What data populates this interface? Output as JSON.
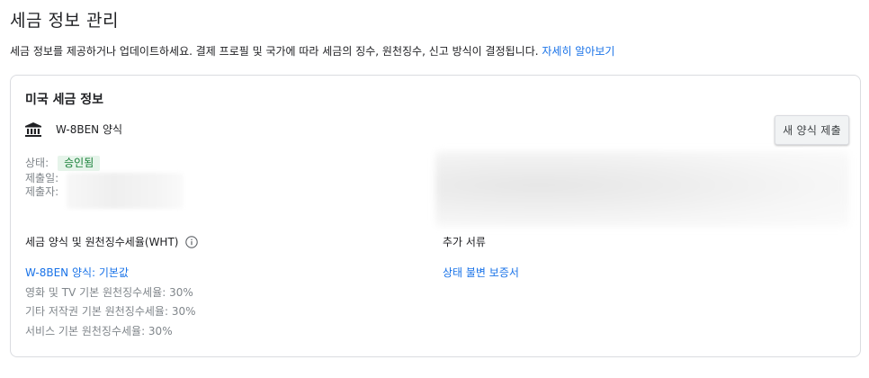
{
  "header": {
    "title": "세금 정보 관리",
    "description": "세금 정보를 제공하거나 업데이트하세요. 결제 프로필 및 국가에 따라 세금의 징수, 원천징수, 신고 방식이 결정됩니다.",
    "learn_more": "자세히 알아보기"
  },
  "card": {
    "title": "미국 세금 정보",
    "form_icon": "bank-icon",
    "form_name": "W-8BEN 양식",
    "submit_button": "새 양식 제출",
    "status_label": "상태:",
    "status_value": "승인됨",
    "submitted_date_label": "제출일:",
    "submitter_label": "제출자:",
    "wht_section_label": "세금 양식 및 원천징수세율(WHT)",
    "info_icon": "info-icon",
    "extra_docs_label": "추가 서류",
    "wht_details": {
      "form_default": "W-8BEN 양식: 기본값",
      "film_tv": "영화 및 TV 기본 원천징수세율: 30%",
      "other_copyright": "기타 저작권 기본 원천징수세율: 30%",
      "services": "서비스 기본 원천징수세율: 30%"
    },
    "extra_docs_link": "상태 불변 보증서"
  },
  "colors": {
    "accent": "#1a73e8",
    "status_bg": "#e6f4ea",
    "status_text": "#188038",
    "muted": "#80868b"
  }
}
